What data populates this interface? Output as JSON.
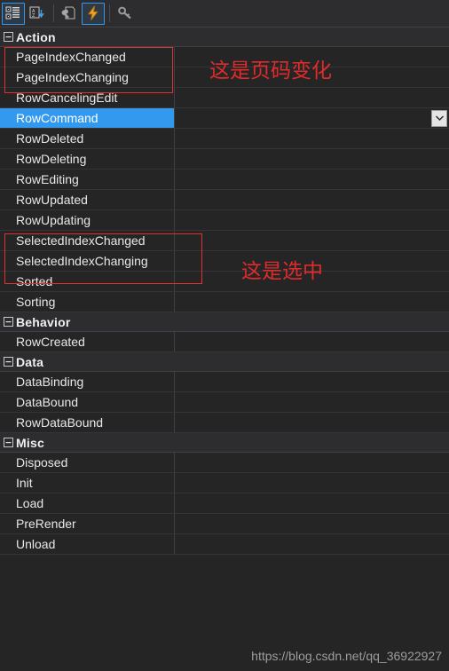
{
  "toolbar": {
    "buttons": [
      {
        "name": "categorized-view-icon",
        "label": "Categorized",
        "active": true
      },
      {
        "name": "alphabetical-sort-icon",
        "label": "Alphabetical",
        "active": false
      },
      {
        "name": "properties-page-icon",
        "label": "Properties",
        "active": false
      },
      {
        "name": "events-lightning-icon",
        "label": "Events",
        "active": true
      },
      {
        "name": "property-pages-key-icon",
        "label": "Property Pages",
        "active": false
      }
    ]
  },
  "grid": {
    "expander_glyph": "-",
    "dropdown_glyph": "chevron-down-icon",
    "selected_property": "RowCommand",
    "categories": [
      {
        "name": "Action",
        "properties": [
          {
            "name": "PageIndexChanged",
            "value": ""
          },
          {
            "name": "PageIndexChanging",
            "value": ""
          },
          {
            "name": "RowCancelingEdit",
            "value": ""
          },
          {
            "name": "RowCommand",
            "value": "",
            "selected": true,
            "has_dropdown": true
          },
          {
            "name": "RowDeleted",
            "value": ""
          },
          {
            "name": "RowDeleting",
            "value": ""
          },
          {
            "name": "RowEditing",
            "value": ""
          },
          {
            "name": "RowUpdated",
            "value": ""
          },
          {
            "name": "RowUpdating",
            "value": ""
          },
          {
            "name": "SelectedIndexChanged",
            "value": ""
          },
          {
            "name": "SelectedIndexChanging",
            "value": ""
          },
          {
            "name": "Sorted",
            "value": ""
          },
          {
            "name": "Sorting",
            "value": ""
          }
        ]
      },
      {
        "name": "Behavior",
        "properties": [
          {
            "name": "RowCreated",
            "value": ""
          }
        ]
      },
      {
        "name": "Data",
        "properties": [
          {
            "name": "DataBinding",
            "value": ""
          },
          {
            "name": "DataBound",
            "value": ""
          },
          {
            "name": "RowDataBound",
            "value": ""
          }
        ]
      },
      {
        "name": "Misc",
        "properties": [
          {
            "name": "Disposed",
            "value": ""
          },
          {
            "name": "Init",
            "value": ""
          },
          {
            "name": "Load",
            "value": ""
          },
          {
            "name": "PreRender",
            "value": ""
          },
          {
            "name": "Unload",
            "value": ""
          }
        ]
      }
    ]
  },
  "annotations": {
    "page_index_note": "这是页码变化",
    "selected_index_note": "这是选中",
    "accent_red": "#e02b2b"
  },
  "watermark": {
    "url": "https://blog.csdn.net/qq_36922927"
  }
}
